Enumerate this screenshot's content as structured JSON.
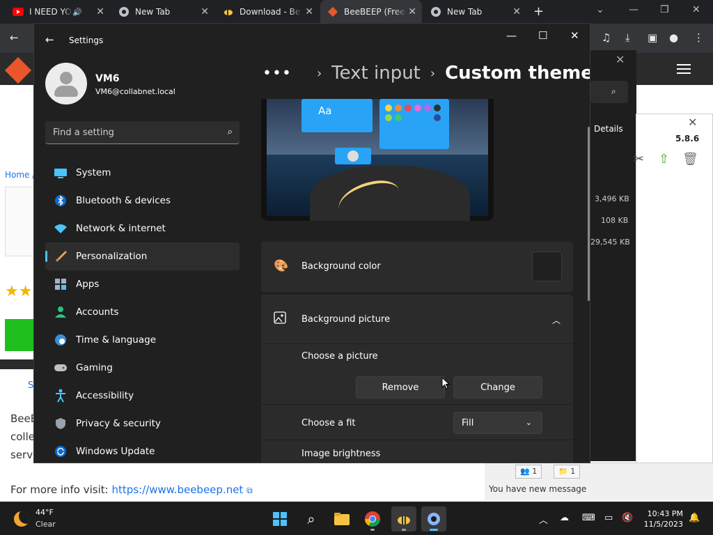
{
  "browser": {
    "tabs": [
      {
        "title": "I NEED YOU"
      },
      {
        "title": "New Tab"
      },
      {
        "title": "Download - Be"
      },
      {
        "title": "BeeBEEP (Free"
      },
      {
        "title": "New Tab"
      }
    ]
  },
  "page": {
    "breadcrumb": "Home /",
    "stext": "S",
    "body_lines": [
      "BeeE",
      "colle",
      "serv"
    ],
    "more_info_label": "For more info visit:",
    "more_info_link": "https://www.beebeep.net"
  },
  "beebeep": {
    "details": "Details",
    "version": "5.8.6",
    "sizes": [
      "3,496 KB",
      "108 KB",
      "29,545 KB"
    ],
    "status_message": "You have new message",
    "badge_a": "1",
    "badge_b": "1"
  },
  "settings": {
    "title": "Settings",
    "user": {
      "name": "VM6",
      "email": "VM6@collabnet.local"
    },
    "search_placeholder": "Find a setting",
    "nav": [
      {
        "label": "System",
        "icon": "system-icon"
      },
      {
        "label": "Bluetooth & devices",
        "icon": "bluetooth-icon"
      },
      {
        "label": "Network & internet",
        "icon": "wifi-icon"
      },
      {
        "label": "Personalization",
        "icon": "brush-icon",
        "active": true
      },
      {
        "label": "Apps",
        "icon": "apps-icon"
      },
      {
        "label": "Accounts",
        "icon": "account-icon"
      },
      {
        "label": "Time & language",
        "icon": "globe-icon"
      },
      {
        "label": "Gaming",
        "icon": "gamepad-icon"
      },
      {
        "label": "Accessibility",
        "icon": "accessibility-icon"
      },
      {
        "label": "Privacy & security",
        "icon": "shield-icon"
      },
      {
        "label": "Windows Update",
        "icon": "update-icon"
      }
    ],
    "breadcrumb": {
      "dots": "•••",
      "parent": "Text input",
      "current": "Custom theme"
    },
    "preview": {
      "sample_text": "Aa"
    },
    "background_color": {
      "label": "Background color",
      "swatch": "#202020"
    },
    "background_picture": {
      "label": "Background picture",
      "choose_label": "Choose a picture",
      "remove_label": "Remove",
      "change_label": "Change",
      "fit_label": "Choose a fit",
      "fit_value": "Fill",
      "brightness_label": "Image brightness"
    }
  },
  "taskbar": {
    "temp": "44°F",
    "condition": "Clear",
    "time": "10:43 PM",
    "date": "11/5/2023"
  },
  "colors": {
    "accent": "#4cc2ff",
    "settings_bg": "#202020",
    "card_bg": "#2b2b2b"
  }
}
